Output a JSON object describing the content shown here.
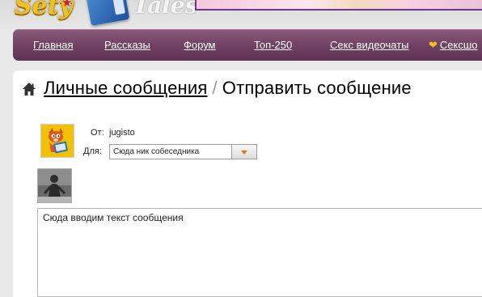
{
  "site": {
    "logo_left": "Sety",
    "logo_right": "Tales"
  },
  "nav": {
    "items": [
      {
        "label": "Главная"
      },
      {
        "label": "Рассказы"
      },
      {
        "label": "Форум"
      },
      {
        "label": "Топ-250"
      },
      {
        "label": "Секс видеочаты"
      },
      {
        "label": "Сексшо",
        "icon": "heart-icon"
      }
    ]
  },
  "breadcrumb": {
    "link": "Личные сообщения",
    "separator": "/",
    "current": "Отправить сообщение"
  },
  "form": {
    "from_label": "От:",
    "from_value": "jugisto",
    "to_label": "Для:",
    "to_value": "Сюда ник собеседника",
    "message_value": "Сюда вводим текст сообщения"
  },
  "colors": {
    "nav_bg": "#6d3e60",
    "accent_orange": "#e07a10",
    "logo_gold": "#f0c21e"
  }
}
